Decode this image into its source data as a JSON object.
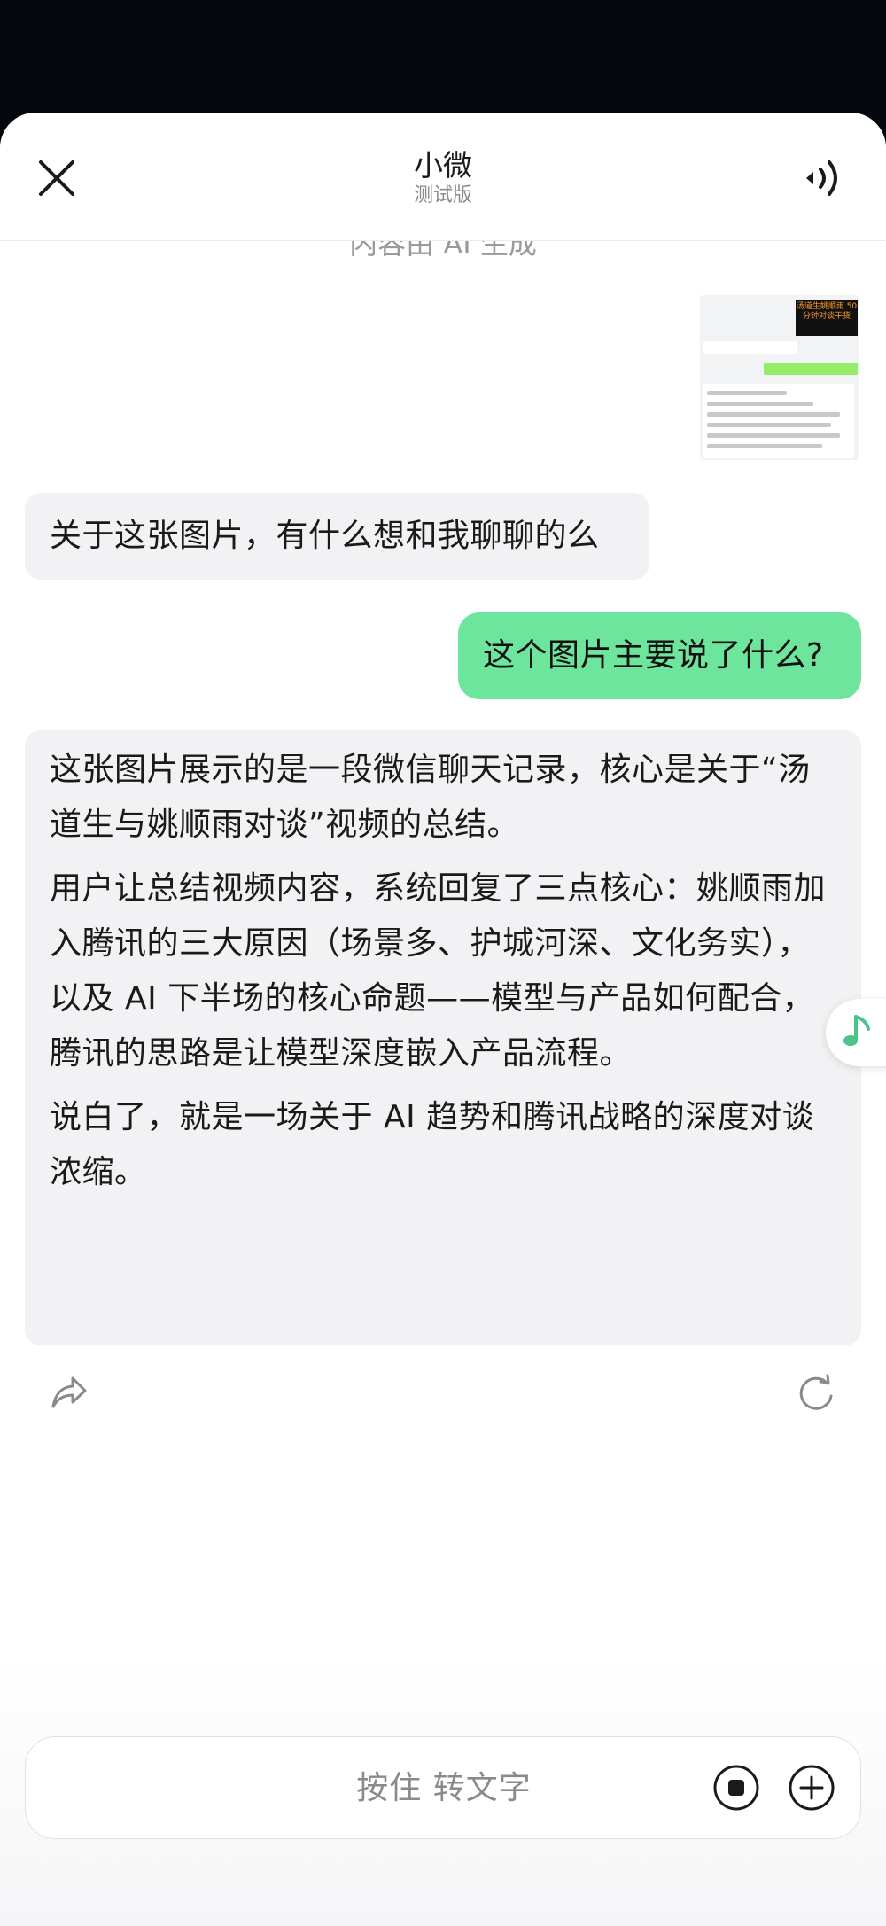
{
  "header": {
    "title": "小微",
    "subtitle": "测试版"
  },
  "ai_notice": "内容由 AI 生成",
  "thumbnail": {
    "video_title": "汤道生姚顺雨 50分钟对谈干货"
  },
  "messages": [
    {
      "role": "assistant",
      "text": "关于这张图片，有什么想和我聊聊的么"
    },
    {
      "role": "user",
      "text": "这个图片主要说了什么?"
    },
    {
      "role": "assistant",
      "paragraphs": [
        "这张图片展示的是一段微信聊天记录，核心是关于“汤道生与姚顺雨对谈”视频的总结。",
        "用户让总结视频内容，系统回复了三点核心：姚顺雨加入腾讯的三大原因（场景多、护城河深、文化务实），以及 AI 下半场的核心命题——模型与产品如何配合，腾讯的思路是让模型深度嵌入产品流程。",
        "说白了，就是一场关于 AI 趋势和腾讯战略的深度对谈浓缩。"
      ]
    }
  ],
  "input": {
    "voice_label": "按住 转文字"
  },
  "colors": {
    "user_bubble": "#6de59d",
    "ai_bubble": "#f2f2f4",
    "accent_green": "#4cc38a"
  },
  "icons": [
    "close-icon",
    "speaker-icon",
    "share-icon",
    "regenerate-icon",
    "music-note-icon",
    "stop-icon",
    "plus-icon"
  ]
}
